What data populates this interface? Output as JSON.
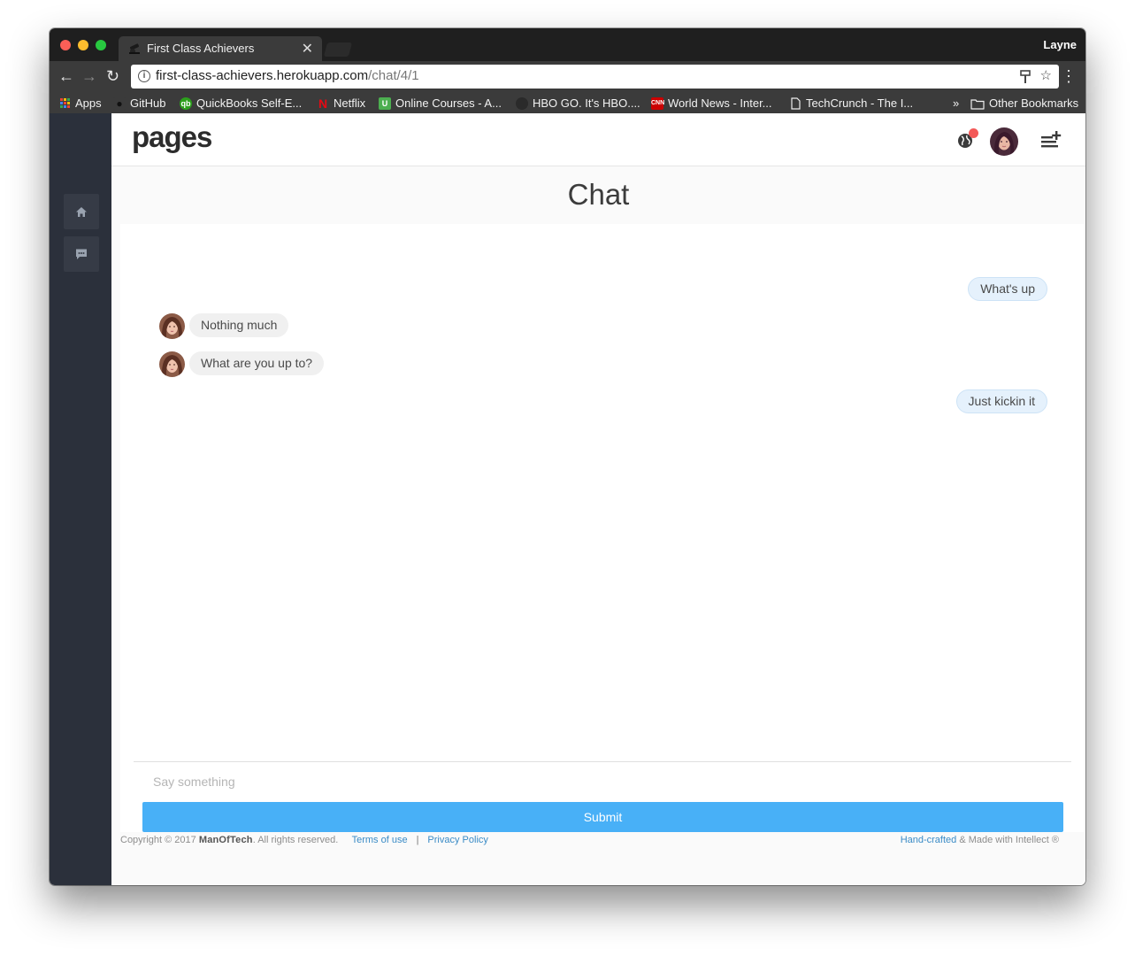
{
  "browser": {
    "tab_title": "First Class Achievers",
    "tab_close": "✕",
    "profile_name": "Layne",
    "url_host": "first-class-achievers.herokuapp.com",
    "url_path": "/chat/4/1",
    "bookmarks": {
      "apps": "Apps",
      "github": "GitHub",
      "quickbooks": "QuickBooks Self-E...",
      "netflix": "Netflix",
      "courses": "Online Courses - A...",
      "hbo": "HBO GO. It's HBO....",
      "cnn": "World News - Inter...",
      "techcrunch": "TechCrunch - The I...",
      "overflow": "»",
      "other": "Other Bookmarks"
    }
  },
  "app": {
    "logo": "pages",
    "page_title": "Chat"
  },
  "messages": [
    {
      "text": "What's up",
      "direction": "outgoing"
    },
    {
      "text": "Nothing much",
      "direction": "incoming"
    },
    {
      "text": "What are you up to?",
      "direction": "incoming"
    },
    {
      "text": "Just kickin it",
      "direction": "outgoing"
    }
  ],
  "composer": {
    "placeholder": "Say something",
    "submit_label": "Submit"
  },
  "footer": {
    "copyright_prefix": "Copyright © 2017",
    "brand": "ManOfTech",
    "rights": ". All rights reserved.",
    "terms": "Terms of use",
    "separator": "|",
    "privacy": "Privacy Policy",
    "handcrafted": "Hand-crafted",
    "made_with": " & Made with Intellect ®"
  },
  "colors": {
    "sidebar": "#2b303b",
    "accent": "#48b0f7",
    "notification": "#f35958",
    "link": "#3a8bc6"
  },
  "icons": {
    "sidebar": [
      "home-icon",
      "chat-icon"
    ],
    "header": [
      "globe-icon",
      "user-avatar",
      "add-list-icon"
    ]
  }
}
